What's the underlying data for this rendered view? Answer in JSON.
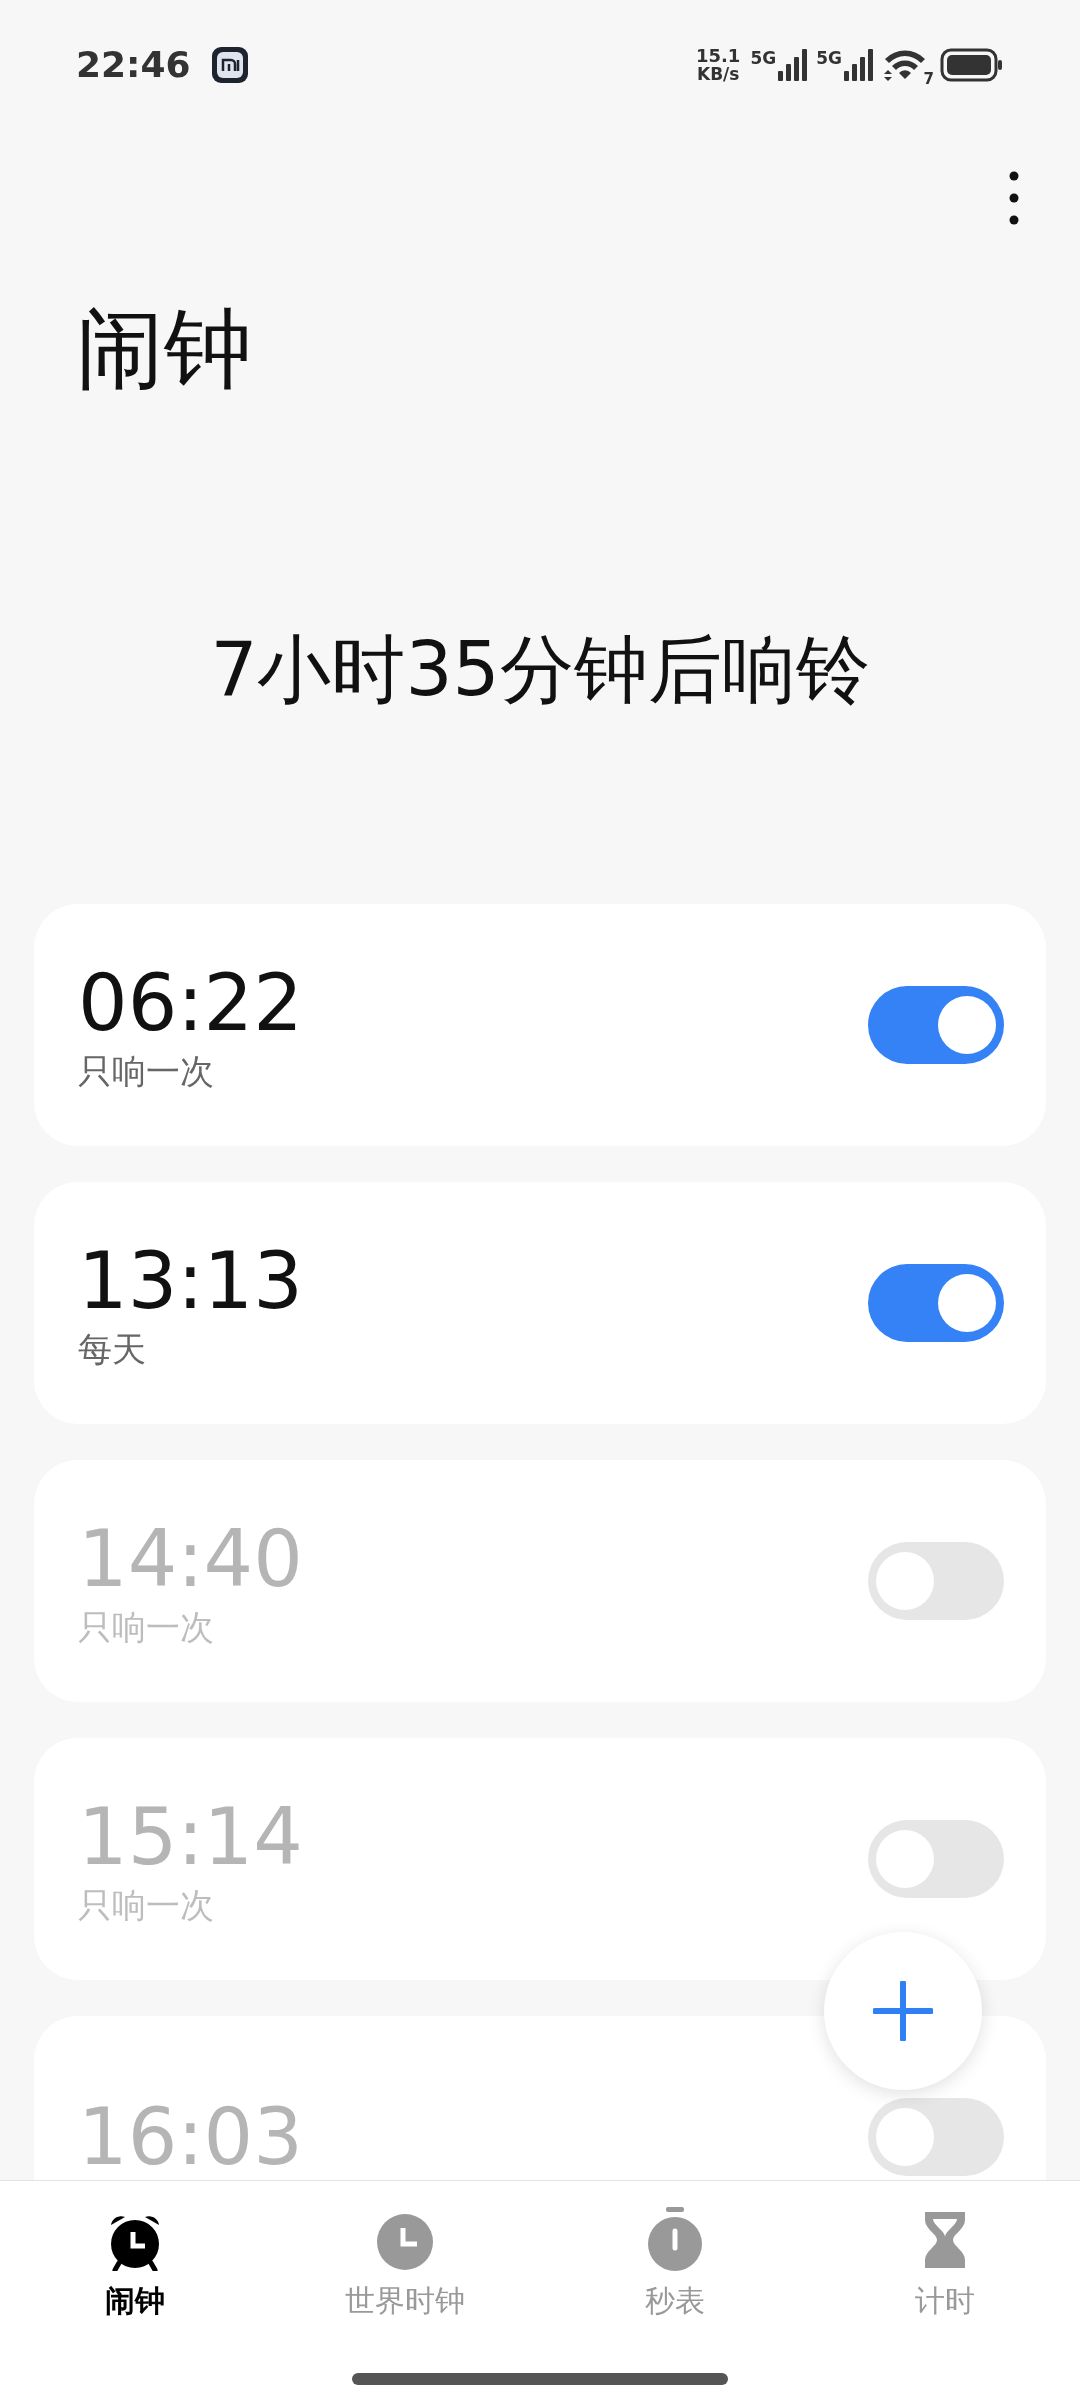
{
  "status_bar": {
    "time": "22:46",
    "speed": "15.1",
    "speed_unit": "KB/s",
    "sim1": "5G",
    "sim2": "5G",
    "wifi_badge": "7"
  },
  "title": "闹钟",
  "next_ring": "7小时35分钟后响铃",
  "alarms": [
    {
      "time": "06:22",
      "repeat": "只响一次",
      "on": true
    },
    {
      "time": "13:13",
      "repeat": "每天",
      "on": true
    },
    {
      "time": "14:40",
      "repeat": "只响一次",
      "on": false
    },
    {
      "time": "15:14",
      "repeat": "只响一次",
      "on": false
    },
    {
      "time": "16:03",
      "on": false
    }
  ],
  "tabs": [
    {
      "label": "闹钟",
      "kind": "alarm",
      "selected": true
    },
    {
      "label": "世界时钟",
      "kind": "clock",
      "selected": false
    },
    {
      "label": "秒表",
      "kind": "stopwatch",
      "selected": false
    },
    {
      "label": "计时",
      "kind": "timer",
      "selected": false
    }
  ]
}
